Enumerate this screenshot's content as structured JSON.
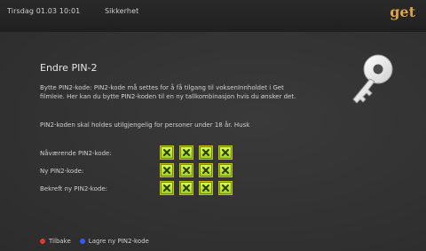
{
  "header": {
    "datetime": "Tirsdag 01.03 10:01",
    "section": "Sikkerhet",
    "logo_text": "get"
  },
  "content": {
    "title": "Endre PIN-2",
    "description": "Bytte PIN2-kode: PIN2-kode må settes for å få tilgang til voksenInnholdet i Get filmleie. Her kan du bytte PIN2-koden til en ny tallkombinasjon hvis du ønsker det.",
    "note": "PIN2-koden skal holdes utilgjengelig for personer under 18 år. Husk",
    "fields": [
      {
        "label": "Nåværende PIN2-kode:",
        "digits": [
          "x",
          "x",
          "x",
          "x"
        ]
      },
      {
        "label": "Ny PIN2-kode:",
        "digits": [
          "x",
          "x",
          "x",
          "x"
        ]
      },
      {
        "label": "Bekreft ny PIN2-kode:",
        "digits": [
          "x",
          "x",
          "x",
          "x"
        ]
      }
    ]
  },
  "footer": {
    "back_label": "Tilbake",
    "save_label": "Lagre ny PIN2-kode"
  },
  "colors": {
    "accent_orange": "#d9a34a",
    "pin_box_green": "#b6ff2a",
    "back_red": "#e03a2d",
    "save_blue": "#2f5cff"
  },
  "icons": {
    "key": "key-icon",
    "x": "x-icon"
  }
}
